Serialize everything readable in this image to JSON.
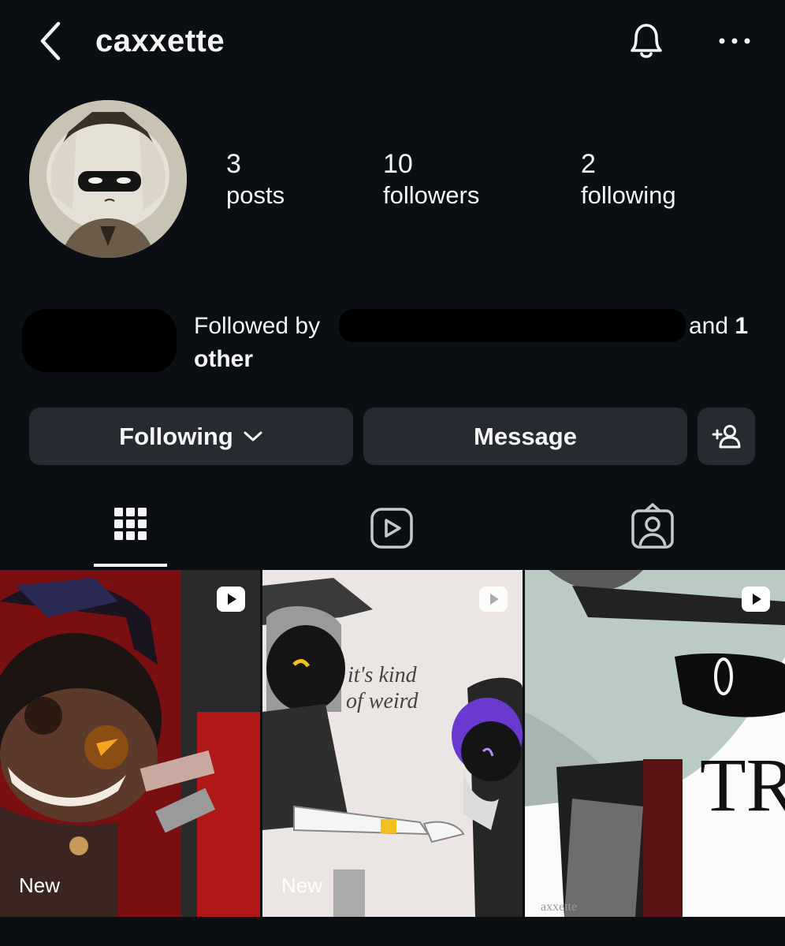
{
  "header": {
    "username": "caxxette",
    "back_icon": "chevron-left-icon",
    "bell_icon": "bell-icon",
    "more_icon": "more-horizontal-icon"
  },
  "profile": {
    "stats": [
      {
        "value": "3",
        "label": "posts"
      },
      {
        "value": "10",
        "label": "followers"
      },
      {
        "value": "2",
        "label": "following"
      }
    ],
    "followed_by": {
      "prefix": "Followed by",
      "and_text": "and",
      "count": "1",
      "suffix": "other"
    }
  },
  "actions": {
    "following_label": "Following",
    "message_label": "Message",
    "add_user_icon": "add-user-icon"
  },
  "tabs": [
    {
      "name": "grid",
      "icon": "grid-icon",
      "active": true
    },
    {
      "name": "reels",
      "icon": "reels-icon",
      "active": false
    },
    {
      "name": "tagged",
      "icon": "tagged-icon",
      "active": false
    }
  ],
  "posts": [
    {
      "badge_icon": "reel-icon",
      "label": "New"
    },
    {
      "badge_icon": "reel-icon",
      "label": "New",
      "caption_line1": "it's kind",
      "caption_line2": "of weird"
    },
    {
      "badge_icon": "reel-icon",
      "label": "",
      "big_text": "TR",
      "watermark": "axxette"
    }
  ],
  "colors": {
    "background": "#0b0f14",
    "button": "#272b31",
    "text": "#f5f5f5"
  }
}
